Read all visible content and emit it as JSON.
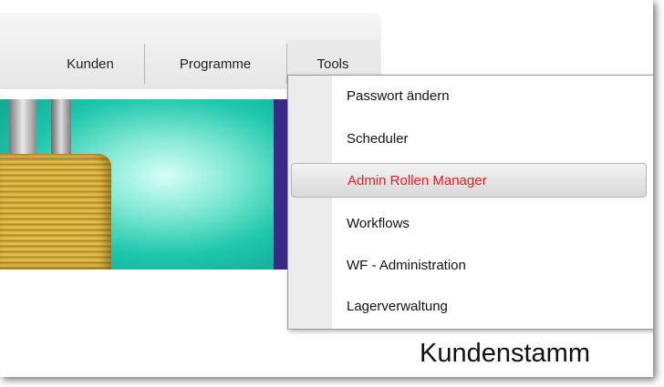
{
  "nav": {
    "items": [
      {
        "label": "Kunden"
      },
      {
        "label": "Programme"
      },
      {
        "label": "Tools"
      }
    ]
  },
  "dropdown": {
    "items": [
      {
        "label": "Passwort ändern"
      },
      {
        "label": "Scheduler"
      },
      {
        "label": "Admin Rollen Manager",
        "state": "hover"
      },
      {
        "label": "Workflows"
      },
      {
        "label": "WF - Administration"
      },
      {
        "label": "Lagerverwaltung"
      }
    ]
  },
  "page": {
    "title": "Kundenstamm"
  },
  "colors": {
    "highlight_text": "#e01f1f",
    "banner_teal": "#1ec7ac",
    "banner_purple": "#3a2a86",
    "banner_red": "#d21414"
  }
}
